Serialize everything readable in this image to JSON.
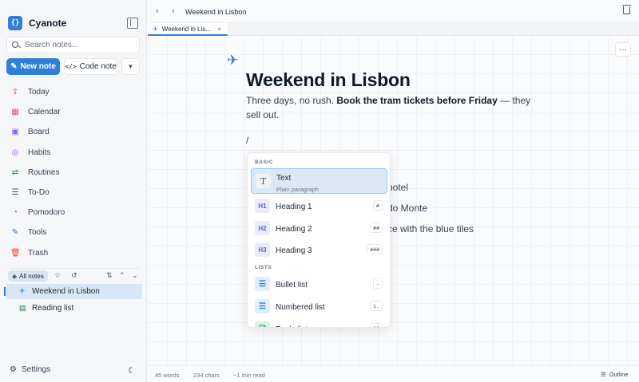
{
  "app": {
    "name": "Cyanote",
    "logo_text": "{}"
  },
  "sidebar": {
    "search_placeholder": "Search notes...",
    "new_note_label": "New note",
    "code_note_label": "Code note",
    "nav": [
      {
        "label": "Today",
        "icon": "today-icon",
        "color": "#ef4444",
        "glyph": "⇪"
      },
      {
        "label": "Calendar",
        "icon": "calendar-icon",
        "color": "#ec4899",
        "glyph": "▦"
      },
      {
        "label": "Board",
        "icon": "board-icon",
        "color": "#8b5cf6",
        "glyph": "▣"
      },
      {
        "label": "Habits",
        "icon": "habits-icon",
        "color": "#a855f7",
        "glyph": "◎"
      },
      {
        "label": "Routines",
        "icon": "routines-icon",
        "color": "#16a34a",
        "glyph": "⇄"
      },
      {
        "label": "To-Do",
        "icon": "todo-icon",
        "color": "#4b5563",
        "glyph": "☰"
      },
      {
        "label": "Pomodoro",
        "icon": "pomodoro-icon",
        "color": "#ef4444",
        "glyph": "◔"
      },
      {
        "label": "Tools",
        "icon": "tools-icon",
        "color": "#2f7fd9",
        "glyph": "✎"
      },
      {
        "label": "Trash",
        "icon": "trash-icon",
        "color": "#ef4444",
        "glyph": "🗑"
      }
    ],
    "notes_filter_label": "All notes",
    "notes": [
      {
        "title": "Weekend in Lisbon",
        "icon": "airplane-icon",
        "glyph": "✈",
        "active": true
      },
      {
        "title": "Reading list",
        "icon": "book-icon",
        "glyph": "▤",
        "active": false
      }
    ],
    "settings_label": "Settings"
  },
  "topbar": {
    "breadcrumb": "Weekend in Lisbon"
  },
  "tab": {
    "label": "Weekend in Lis...",
    "close": "×"
  },
  "editor": {
    "emoji": "✈",
    "title": "Weekend in Lisbon",
    "para_pre": "Three days, no rush. ",
    "para_bold": "Book the tram tickets before Friday",
    "para_post": " — they sell out.",
    "slash_text": "/",
    "obscured_lines": [
      "hotel",
      "do Monte",
      "ce with the blue tiles"
    ]
  },
  "slash_menu": {
    "sections": [
      {
        "label": "BASIC",
        "items": [
          {
            "label": "Text",
            "sub": "Plain paragraph",
            "icon": "text-icon",
            "glyph": "T",
            "shortcut": "",
            "selected": true
          },
          {
            "label": "Heading 1",
            "sub": "",
            "icon": "heading1-icon",
            "glyph": "H1",
            "shortcut": "#",
            "selected": false
          },
          {
            "label": "Heading 2",
            "sub": "",
            "icon": "heading2-icon",
            "glyph": "H2",
            "shortcut": "##",
            "selected": false
          },
          {
            "label": "Heading 3",
            "sub": "",
            "icon": "heading3-icon",
            "glyph": "H3",
            "shortcut": "###",
            "selected": false
          }
        ]
      },
      {
        "label": "LISTS",
        "items": [
          {
            "label": "Bullet list",
            "sub": "",
            "icon": "bullet-list-icon",
            "glyph": "☰",
            "shortcut": "-",
            "selected": false
          },
          {
            "label": "Numbered list",
            "sub": "",
            "icon": "numbered-list-icon",
            "glyph": "☰",
            "shortcut": "1.",
            "selected": false
          },
          {
            "label": "To-do list",
            "sub": "",
            "icon": "todo-list-icon",
            "glyph": "☑",
            "shortcut": "[]",
            "selected": false
          }
        ]
      }
    ]
  },
  "status": {
    "words": "45 words",
    "chars": "234 chars",
    "read_time": "~1 min read",
    "outline_label": "Outline"
  },
  "colors": {
    "accent": "#2f7fd9",
    "selected_bg": "#dbe9f7"
  }
}
